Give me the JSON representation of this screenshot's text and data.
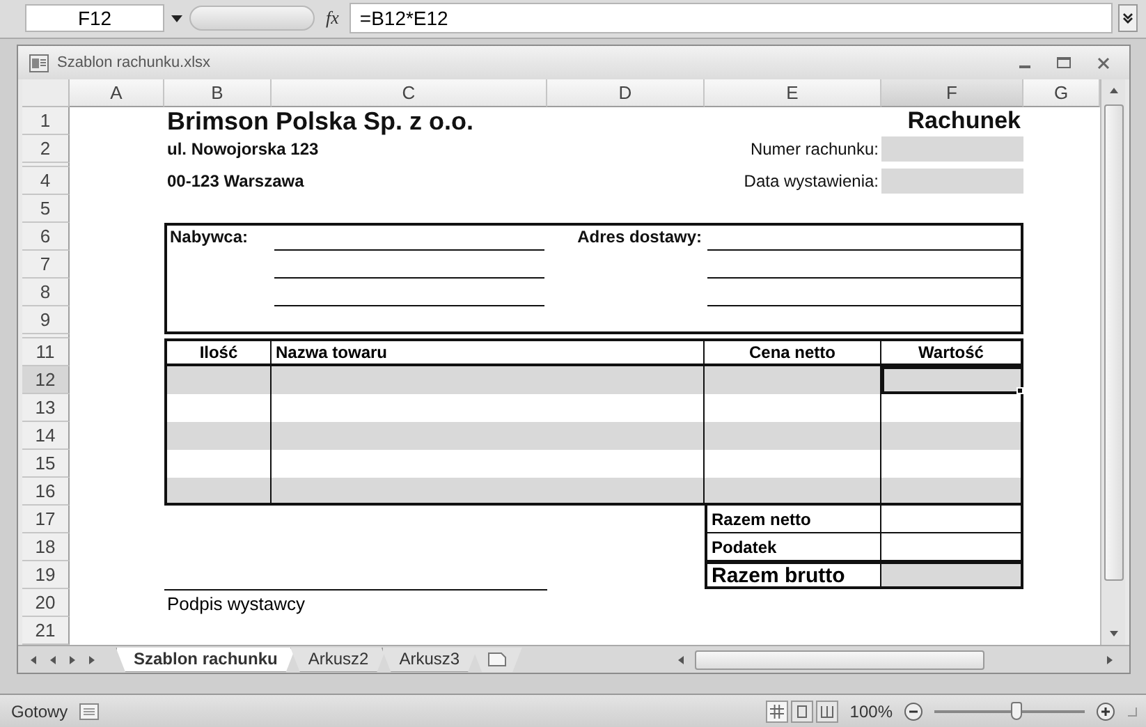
{
  "formula_bar": {
    "name_box": "F12",
    "function_label": "fx",
    "formula": "=B12*E12"
  },
  "window": {
    "title": "Szablon rachunku.xlsx"
  },
  "columns": [
    {
      "label": "A",
      "selected": false
    },
    {
      "label": "B",
      "selected": false
    },
    {
      "label": "C",
      "selected": false
    },
    {
      "label": "D",
      "selected": false
    },
    {
      "label": "E",
      "selected": false
    },
    {
      "label": "F",
      "selected": true
    },
    {
      "label": "G",
      "selected": false
    }
  ],
  "rows": [
    {
      "label": "1",
      "kind": "normal",
      "selected": false
    },
    {
      "label": "2",
      "kind": "normal",
      "selected": false
    },
    {
      "kind": "collapsed",
      "selected": false
    },
    {
      "label": "4",
      "kind": "normal",
      "selected": false
    },
    {
      "label": "5",
      "kind": "normal",
      "selected": false
    },
    {
      "label": "6",
      "kind": "normal",
      "selected": false
    },
    {
      "label": "7",
      "kind": "normal",
      "selected": false
    },
    {
      "label": "8",
      "kind": "normal",
      "selected": false
    },
    {
      "label": "9",
      "kind": "normal",
      "selected": false
    },
    {
      "kind": "collapsed",
      "selected": false
    },
    {
      "label": "11",
      "kind": "normal",
      "selected": false
    },
    {
      "label": "12",
      "kind": "normal",
      "selected": true
    },
    {
      "label": "13",
      "kind": "normal",
      "selected": false
    },
    {
      "label": "14",
      "kind": "normal",
      "selected": false
    },
    {
      "label": "15",
      "kind": "normal",
      "selected": false
    },
    {
      "label": "16",
      "kind": "normal",
      "selected": false
    },
    {
      "label": "17",
      "kind": "normal",
      "selected": false
    },
    {
      "label": "18",
      "kind": "normal",
      "selected": false
    },
    {
      "label": "19",
      "kind": "normal",
      "selected": false
    },
    {
      "label": "20",
      "kind": "normal",
      "selected": false
    },
    {
      "label": "21",
      "kind": "normal",
      "selected": false
    }
  ],
  "invoice": {
    "company": "Brimson Polska Sp. z o.o.",
    "title": "Rachunek",
    "street": "ul. Nowojorska 123",
    "city": "00-123 Warszawa",
    "fields": [
      {
        "label": "Numer rachunku:"
      },
      {
        "label": "Data wystawienia:"
      }
    ],
    "buyer_label": "Nabywca:",
    "delivery_label": "Adres dostawy:",
    "items_columns": [
      "Ilość",
      "Nazwa towaru",
      "Cena netto",
      "Wartość"
    ],
    "items_rows": [
      {
        "shaded": true
      },
      {
        "shaded": false
      },
      {
        "shaded": true
      },
      {
        "shaded": false
      },
      {
        "shaded": true
      }
    ],
    "totals": [
      {
        "label": "Razem netto",
        "kind": "normal"
      },
      {
        "label": "Podatek",
        "kind": "normal"
      },
      {
        "label": "Razem brutto",
        "kind": "grand"
      }
    ],
    "signature_label": "Podpis wystawcy"
  },
  "sheet_tabs": [
    {
      "label": "Szablon rachunku",
      "selected": true
    },
    {
      "label": "Arkusz2",
      "selected": false
    },
    {
      "label": "Arkusz3",
      "selected": false
    }
  ],
  "status_bar": {
    "status": "Gotowy",
    "zoom": "100%",
    "zoom_level": {
      "level": 0.55
    }
  }
}
